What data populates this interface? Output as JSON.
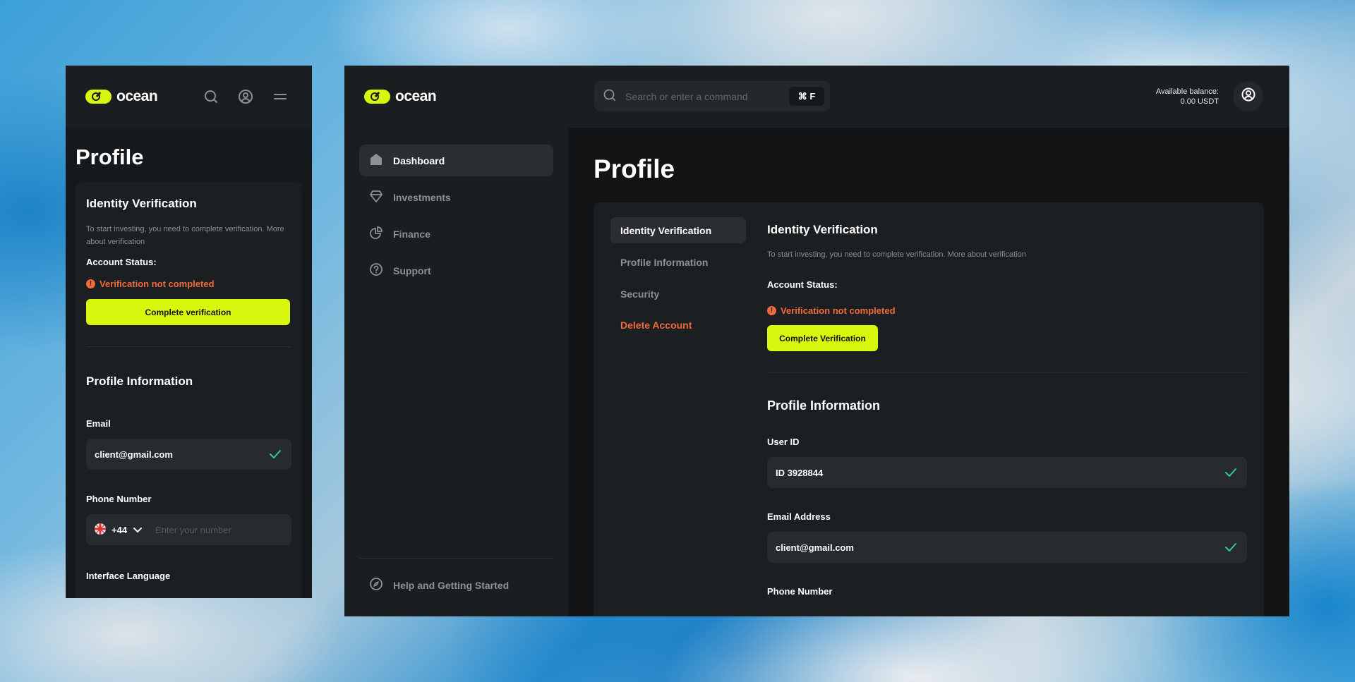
{
  "brand": {
    "name": "ocean",
    "accent": "#d8f70e",
    "warning": "#f06a3a",
    "success": "#2ecf8a"
  },
  "mobile": {
    "page_title": "Profile",
    "icons": [
      "search-icon",
      "user-circle-icon",
      "menu-icon"
    ],
    "identity": {
      "title": "Identity Verification",
      "description": "To start investing, you need to complete verification. More about verification",
      "status_label": "Account Status:",
      "status_value": "Verification not completed",
      "button": "Complete verification"
    },
    "profile": {
      "title": "Profile Information",
      "email_label": "Email",
      "email_value": "client@gmail.com",
      "phone_label": "Phone Number",
      "phone_code": "+44",
      "phone_placeholder": "Enter your number",
      "language_label": "Interface Language"
    }
  },
  "desktop": {
    "nav": [
      {
        "label": "Dashboard",
        "icon": "home-icon",
        "active": true
      },
      {
        "label": "Investments",
        "icon": "diamond-icon",
        "active": false
      },
      {
        "label": "Finance",
        "icon": "pie-chart-icon",
        "active": false
      },
      {
        "label": "Support",
        "icon": "help-circle-icon",
        "active": false
      }
    ],
    "help": "Help and Getting Started",
    "search_placeholder": "Search or enter a command",
    "shortcut": "⌘ F",
    "balance_label": "Available balance:",
    "balance_value": "0.00 USDT",
    "page_title": "Profile",
    "tabs": [
      "Identity Verification",
      "Profile Information",
      "Security",
      "Delete Account"
    ],
    "identity": {
      "title": "Identity Verification",
      "description": "To start investing, you need to complete verification. More about verification",
      "status_label": "Account Status:",
      "status_value": "Verification not completed",
      "button": "Complete Verification"
    },
    "profile": {
      "title": "Profile Information",
      "userid_label": "User ID",
      "userid_value": "ID 3928844",
      "email_label": "Email Address",
      "email_value": "client@gmail.com",
      "phone_label": "Phone Number"
    }
  }
}
